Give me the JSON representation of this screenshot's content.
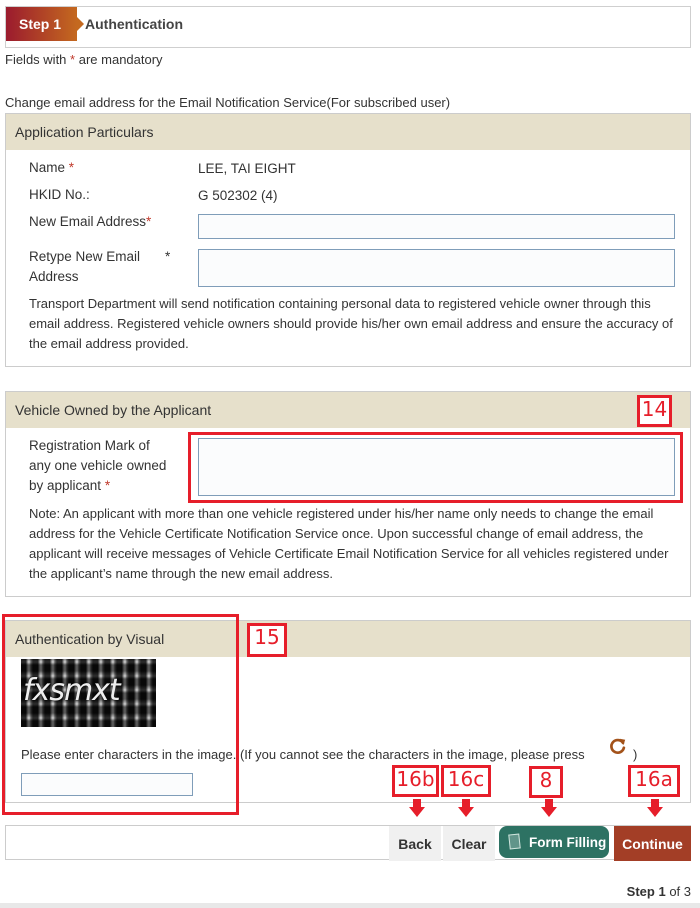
{
  "step_header": {
    "step_label": "Step 1",
    "title": "Authentication"
  },
  "mandatory_note": {
    "prefix": "Fields with",
    "asterisk": "*",
    "suffix": "are mandatory"
  },
  "intro": "Change email address for the Email Notification Service(For subscribed user)",
  "application_particulars": {
    "heading": "Application Particulars",
    "name_label": "Name",
    "name_value": "LEE, TAI EIGHT",
    "hkid_label": "HKID No.:",
    "hkid_value": "G 502302 (4)",
    "new_email_label": "New Email Address",
    "new_email_value": "",
    "retype_email_label_line1": "Retype New Email",
    "retype_email_label_line2": "Address",
    "retype_email_value": "",
    "required_mark": "*",
    "notice": "Transport Department will send notification containing personal data to registered vehicle owner through this email address. Registered vehicle owners should provide his/her own email address and ensure the accuracy of the email address provided."
  },
  "vehicle": {
    "heading": "Vehicle Owned by the Applicant",
    "reg_label_line1": "Registration Mark of",
    "reg_label_line2": "any one vehicle owned",
    "reg_label_line3": "by applicant",
    "required_mark": "*",
    "reg_value": "",
    "note": "Note: An applicant with more than one vehicle registered under his/her name only needs to change the email address for the Vehicle Certificate Notification Service once. Upon successful change of email address, the applicant will receive messages of Vehicle Certificate Email Notification Service for all vehicles registered under the applicant’s name through the new email address."
  },
  "visual_auth": {
    "heading": "Authentication by Visual",
    "captcha_text": "fxsmxt",
    "instruction": "Please enter characters in the image. (If you cannot see the characters in the image, please press",
    "instruction_end": ")",
    "refresh_icon": "refresh-icon",
    "captcha_value": ""
  },
  "actions": {
    "back": "Back",
    "clear": "Clear",
    "form_filling": "Form Filling",
    "continue": "Continue"
  },
  "step_count": {
    "prefix": "Step",
    "current": "1",
    "suffix": "of 3"
  },
  "annotations": {
    "vehicle_reg": "14",
    "visual_auth": "15",
    "back": "16b",
    "clear": "16c",
    "form_filling": "8",
    "continue": "16a",
    "color": "#e61e2a"
  },
  "colors": {
    "panel_header_bg": "#e6e0cb",
    "form_filling_bg": "#2d7263",
    "continue_bg": "#a33e26",
    "step_gradient_start": "#9b1b2e",
    "step_gradient_end": "#c4691f"
  }
}
